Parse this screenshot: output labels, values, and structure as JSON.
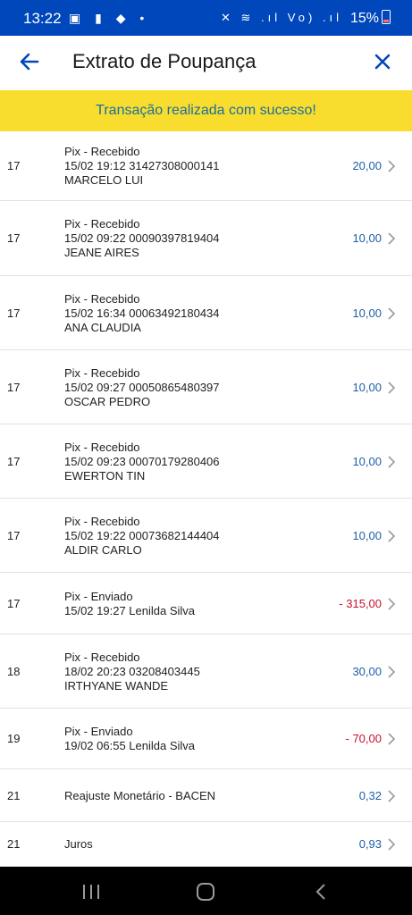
{
  "status_bar": {
    "time": "13:22",
    "battery": "15%",
    "left_icons": "▣ ▮ ◆ •",
    "right_icons": "✕ ≋ .ıl Vo) .ıl"
  },
  "header": {
    "title": "Extrato de Poupança"
  },
  "banner": {
    "message": "Transação realizada com sucesso!"
  },
  "transactions": [
    {
      "day": "17",
      "line1": "Pix - Recebido",
      "line2": "15/02 19:12 31427308000141",
      "line3": "MARCELO LUI",
      "amount": "20,00",
      "type": "pos"
    },
    {
      "day": "17",
      "line1": "Pix - Recebido",
      "line2": "15/02 09:22 00090397819404",
      "line3": "JEANE AIRES",
      "amount": "10,00",
      "type": "pos"
    },
    {
      "day": "17",
      "line1": "Pix - Recebido",
      "line2": "15/02 16:34 00063492180434",
      "line3": "ANA CLAUDIA",
      "amount": "10,00",
      "type": "pos"
    },
    {
      "day": "17",
      "line1": "Pix - Recebido",
      "line2": "15/02 09:27 00050865480397",
      "line3": "OSCAR PEDRO",
      "amount": "10,00",
      "type": "pos"
    },
    {
      "day": "17",
      "line1": "Pix - Recebido",
      "line2": "15/02 09:23 00070179280406",
      "line3": "EWERTON TIN",
      "amount": "10,00",
      "type": "pos"
    },
    {
      "day": "17",
      "line1": "Pix - Recebido",
      "line2": "15/02 19:22 00073682144404",
      "line3": "ALDIR CARLO",
      "amount": "10,00",
      "type": "pos"
    },
    {
      "day": "17",
      "line1": "Pix - Enviado",
      "line2": "15/02 19:27 Lenilda Silva",
      "line3": "",
      "amount": "- 315,00",
      "type": "neg"
    },
    {
      "day": "18",
      "line1": "Pix - Recebido",
      "line2": "18/02 20:23 03208403445",
      "line3": "IRTHYANE WANDE",
      "amount": "30,00",
      "type": "pos"
    },
    {
      "day": "19",
      "line1": "Pix - Enviado",
      "line2": "19/02 06:55 Lenilda Silva",
      "line3": "",
      "amount": "- 70,00",
      "type": "neg"
    },
    {
      "day": "21",
      "line1": "Reajuste Monetário - BACEN",
      "line2": "",
      "line3": "",
      "amount": "0,32",
      "type": "pos"
    },
    {
      "day": "21",
      "line1": "Juros",
      "line2": "",
      "line3": "",
      "amount": "0,93",
      "type": "pos"
    }
  ],
  "colors": {
    "brand_blue": "#0047bb",
    "banner_yellow": "#f8dd2e",
    "positive": "#1f5fa6",
    "negative": "#c8102e"
  }
}
